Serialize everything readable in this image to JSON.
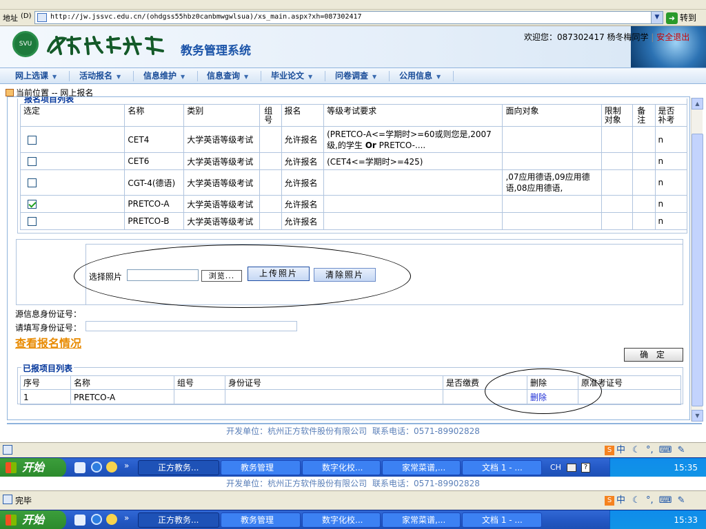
{
  "browser": {
    "address_label": "地址",
    "url": "http://jw.jssvc.edu.cn/(ohdgss55hbz0canbmwgwlsua)/xs_main.aspx?xh=087302417",
    "go_label": "转到",
    "status_text": "完毕"
  },
  "header": {
    "logo_text": "苏州市职业大学",
    "system_title": "教务管理系统",
    "welcome_label": "欢迎您：087302417 杨冬梅同学",
    "separator": "|",
    "logout_label": "安全退出"
  },
  "nav": {
    "items": [
      {
        "label": "网上选课"
      },
      {
        "label": "活动报名"
      },
      {
        "label": "信息维护"
      },
      {
        "label": "信息查询"
      },
      {
        "label": "毕业论文"
      },
      {
        "label": "问卷调查"
      },
      {
        "label": "公用信息"
      }
    ]
  },
  "breadcrumb": {
    "label": "当前位置",
    "path": "-- 网上报名"
  },
  "registration_table": {
    "legend": "报名项目列表",
    "headers": [
      "选定",
      "名称",
      "类别",
      "组号",
      "报名",
      "等级考试要求",
      "面向对象",
      "限制对象",
      "备注",
      "是否补考"
    ],
    "rows": [
      {
        "checked": false,
        "name": "CET4",
        "category": "大学英语等级考试",
        "group": "",
        "status": "允许报名",
        "requirement_a": "(PRETCO-A<=学期时>=60或则您是,2007级,的学生",
        "requirement_or": "Or",
        "requirement_b": "PRETCO-....",
        "target": "",
        "restrict": "",
        "remark": "",
        "makeup": "n"
      },
      {
        "checked": false,
        "name": "CET6",
        "category": "大学英语等级考试",
        "group": "",
        "status": "允许报名",
        "requirement_a": "(CET4<=学期时>=425)",
        "requirement_or": "",
        "requirement_b": "",
        "target": "",
        "restrict": "",
        "remark": "",
        "makeup": "n"
      },
      {
        "checked": false,
        "name": "CGT-4(德语)",
        "category": "大学英语等级考试",
        "group": "",
        "status": "允许报名",
        "requirement_a": "",
        "requirement_or": "",
        "requirement_b": "",
        "target": ",07应用德语,09应用德语,08应用德语,",
        "restrict": "",
        "remark": "",
        "makeup": "n"
      },
      {
        "checked": true,
        "name": "PRETCO-A",
        "category": "大学英语等级考试",
        "group": "",
        "status": "允许报名",
        "requirement_a": "",
        "requirement_or": "",
        "requirement_b": "",
        "target": "",
        "restrict": "",
        "remark": "",
        "makeup": "n"
      },
      {
        "checked": false,
        "name": "PRETCO-B",
        "category": "大学英语等级考试",
        "group": "",
        "status": "允许报名",
        "requirement_a": "",
        "requirement_or": "",
        "requirement_b": "",
        "target": "",
        "restrict": "",
        "remark": "",
        "makeup": "n"
      }
    ]
  },
  "photo": {
    "label": "选择照片",
    "input_value": "",
    "browse_label": "浏览...",
    "upload_label": "上传照片",
    "clear_label": "清除照片"
  },
  "id_section": {
    "source_label": "源信息身份证号：",
    "fill_label": "请填写身份证号：",
    "fill_value": ""
  },
  "view_link": "查看报名情况",
  "confirm_label": "确  定",
  "registered": {
    "legend": "已报项目列表",
    "headers": [
      "序号",
      "名称",
      "组号",
      "身份证号",
      "是否缴费",
      "删除",
      "原准考证号"
    ],
    "rows": [
      {
        "index": "1",
        "name": "PRETCO-A",
        "group": "",
        "id_number": "",
        "paid": "",
        "delete_label": "删除",
        "ticket": ""
      }
    ]
  },
  "footer": {
    "developer": "开发单位：杭州正方软件股份有限公司",
    "phone": "联系电话：0571-89902828"
  },
  "taskbar": {
    "start_label": "开始",
    "buttons": [
      {
        "label": "正方教务..."
      },
      {
        "label": "教务管理"
      },
      {
        "label": "数字化校..."
      },
      {
        "label": "家常菜谱,..."
      },
      {
        "label": "文档 1 - ..."
      }
    ],
    "lang": "CH",
    "ime_label": "中",
    "clock_1": "15:35",
    "clock_2": "15:33"
  }
}
